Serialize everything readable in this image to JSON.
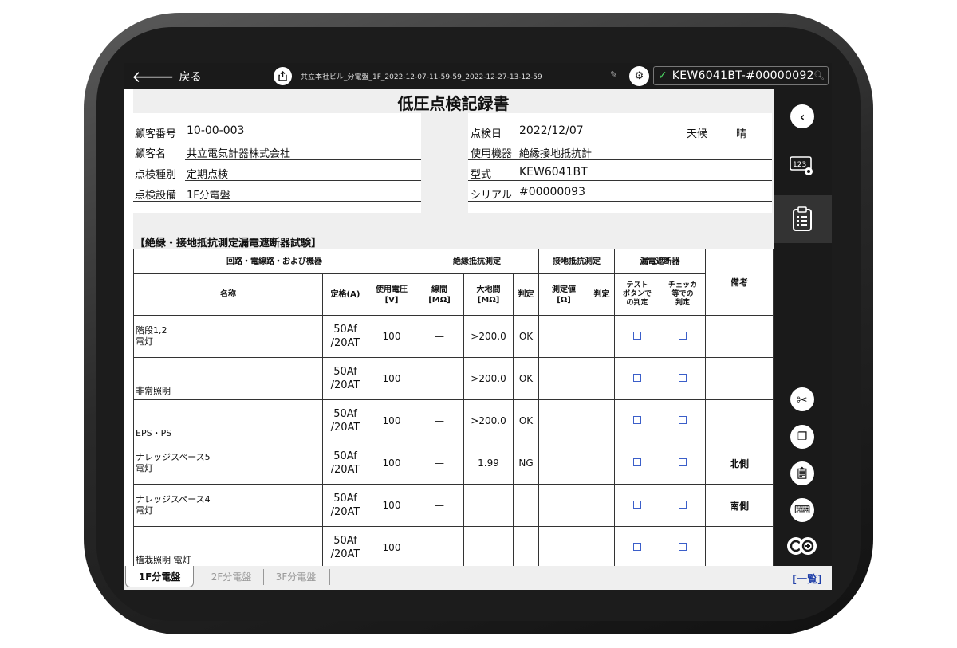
{
  "topbar": {
    "back_label": "戻る",
    "file_name": "共立本社ビル_分電盤_1F_2022-12-07-11-59-59_2022-12-27-13-12-59",
    "device": "KEW6041BT-#00000092"
  },
  "doc": {
    "title": "低圧点検記録書",
    "customer_no_label": "顧客番号",
    "customer_no": "10-00-003",
    "customer_name_label": "顧客名",
    "customer_name": "共立電気計器株式会社",
    "inspect_type_label": "点検種別",
    "inspect_type": "定期点検",
    "equipment_label": "点検設備",
    "equipment": "1F分電盤",
    "date_label": "点検日",
    "date": "2022/12/07",
    "weather_label": "天候",
    "weather": "晴",
    "instrument_label": "使用機器",
    "instrument": "絶縁接地抵抗計",
    "model_label": "型式",
    "model": "KEW6041BT",
    "serial_label": "シリアル",
    "serial": "#00000093",
    "section_title": "【絶縁・接地抵抗測定漏電遮断器試験】"
  },
  "table": {
    "group_circuit": "回路・電線路・および機器",
    "group_insulation": "絶縁抵抗測定",
    "group_ground": "接地抵抗測定",
    "group_breaker": "漏電遮断器",
    "col_remarks": "備考",
    "col_name": "名称",
    "col_rating": "定格(A)",
    "col_voltage_1": "使用電圧",
    "col_voltage_2": "[V]",
    "col_line_1": "線間",
    "col_line_2": "[MΩ]",
    "col_earth_1": "大地間",
    "col_earth_2": "[MΩ]",
    "col_judge": "判定",
    "col_measured_1": "測定値",
    "col_measured_2": "[Ω]",
    "col_judge2": "判定",
    "col_test_1": "テスト",
    "col_test_2": "ボタンで",
    "col_test_3": "の判定",
    "col_checker_1": "チェッカ",
    "col_checker_2": "等での",
    "col_checker_3": "判定",
    "rows": [
      {
        "name1": "階段1,2",
        "name2": "電灯",
        "rating1": "50Af",
        "rating2": "/20AT",
        "voltage": "100",
        "line": "—",
        "earth": ">200.0",
        "judge": "OK",
        "remarks": ""
      },
      {
        "name1": "",
        "name2": "非常照明",
        "rating1": "50Af",
        "rating2": "/20AT",
        "voltage": "100",
        "line": "—",
        "earth": ">200.0",
        "judge": "OK",
        "remarks": ""
      },
      {
        "name1": "",
        "name2": "EPS・PS",
        "rating1": "50Af",
        "rating2": "/20AT",
        "voltage": "100",
        "line": "—",
        "earth": ">200.0",
        "judge": "OK",
        "remarks": ""
      },
      {
        "name1": "ナレッジスペース5",
        "name2": "電灯",
        "rating1": "50Af",
        "rating2": "/20AT",
        "voltage": "100",
        "line": "—",
        "earth": "1.99",
        "judge": "NG",
        "remarks": "北側"
      },
      {
        "name1": "ナレッジスペース4",
        "name2": "電灯",
        "rating1": "50Af",
        "rating2": "/20AT",
        "voltage": "100",
        "line": "—",
        "earth": "",
        "judge": "",
        "remarks": "南側"
      },
      {
        "name1": "",
        "name2": "植栽照明 電灯",
        "rating1": "50Af",
        "rating2": "/20AT",
        "voltage": "100",
        "line": "—",
        "earth": "",
        "judge": "",
        "remarks": ""
      }
    ]
  },
  "tabs": {
    "t1": "1F分電盤",
    "t2": "2F分電盤",
    "t3": "3F分電盤",
    "list_link": "[一覧]"
  },
  "colors": {
    "chrome": "#1a1a1a",
    "accent_link": "#1f3fa8",
    "checkbox": "#3b5ec9",
    "connected": "#4cd964"
  }
}
